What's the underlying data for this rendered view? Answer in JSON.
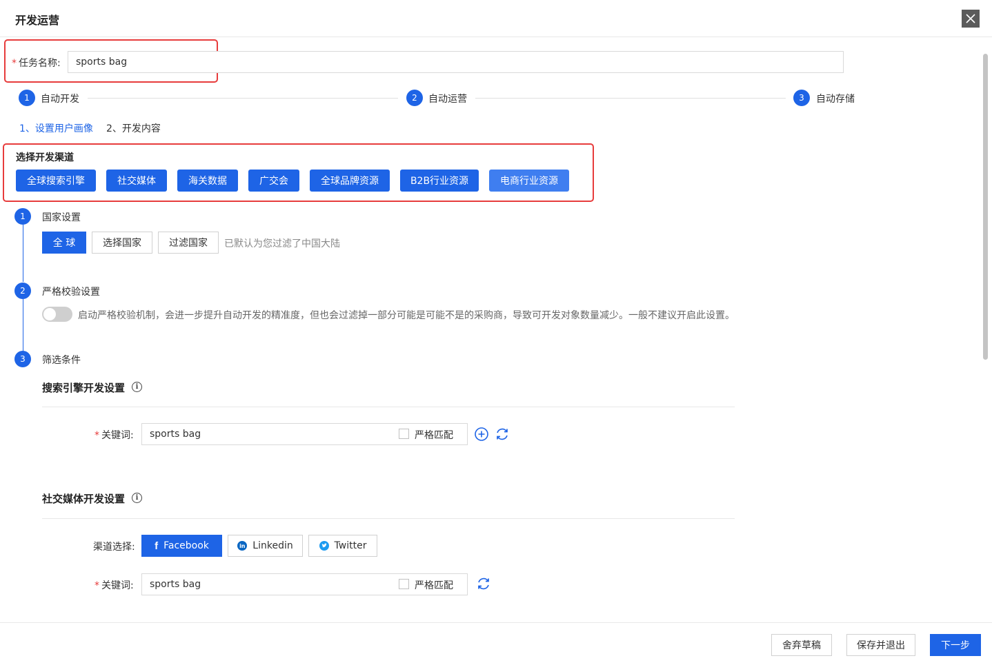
{
  "dialog": {
    "title": "开发运营",
    "close_icon": "✕"
  },
  "task": {
    "label": "任务名称:",
    "required_mark": "*",
    "value": "sports bag"
  },
  "steps": [
    {
      "number": "1",
      "label": "自动开发"
    },
    {
      "number": "2",
      "label": "自动运营"
    },
    {
      "number": "3",
      "label": "自动存储"
    }
  ],
  "subtabs": [
    {
      "label": "1、设置用户画像",
      "active": true
    },
    {
      "label": "2、开发内容",
      "active": false
    }
  ],
  "channels": {
    "title": "选择开发渠道",
    "buttons": [
      "全球搜索引擎",
      "社交媒体",
      "海关数据",
      "广交会",
      "全球品牌资源",
      "B2B行业资源",
      "电商行业资源"
    ]
  },
  "country": {
    "number": "1",
    "title": "国家设置",
    "options": [
      "全 球",
      "选择国家",
      "过滤国家"
    ],
    "selected": "全 球",
    "hint": "已默认为您过滤了中国大陆"
  },
  "strict": {
    "number": "2",
    "title": "严格校验设置",
    "enabled": false,
    "description": "启动严格校验机制，会进一步提升自动开发的精准度，但也会过滤掉一部分可能是可能不是的采购商，导致可开发对象数量减少。一般不建议开启此设置。"
  },
  "filter": {
    "number": "3",
    "title": "筛选条件",
    "search_engine": {
      "title": "搜索引擎开发设置",
      "keyword_label": "关键词:",
      "required_mark": "*",
      "keyword_value": "sports bag",
      "strict_match_label": "严格匹配",
      "strict_match_checked": false
    },
    "social_media": {
      "title": "社交媒体开发设置",
      "channel_label": "渠道选择:",
      "channels": [
        {
          "label": "Facebook",
          "icon": "f",
          "active": true
        },
        {
          "label": "Linkedin",
          "icon": "in",
          "active": false
        },
        {
          "label": "Twitter",
          "icon": "t",
          "active": false
        }
      ],
      "keyword_label": "关键词:",
      "required_mark": "*",
      "keyword_value": "sports bag",
      "strict_match_label": "严格匹配",
      "strict_match_checked": false
    }
  },
  "footer": {
    "discard_label": "舍弃草稿",
    "save_exit_label": "保存并退出",
    "next_label": "下一步"
  },
  "colors": {
    "primary": "#1e64e6",
    "highlight_border": "#e73b3b",
    "required": "#e73b3b",
    "linkedin": "#0a66c2",
    "twitter": "#1d9bf0"
  }
}
